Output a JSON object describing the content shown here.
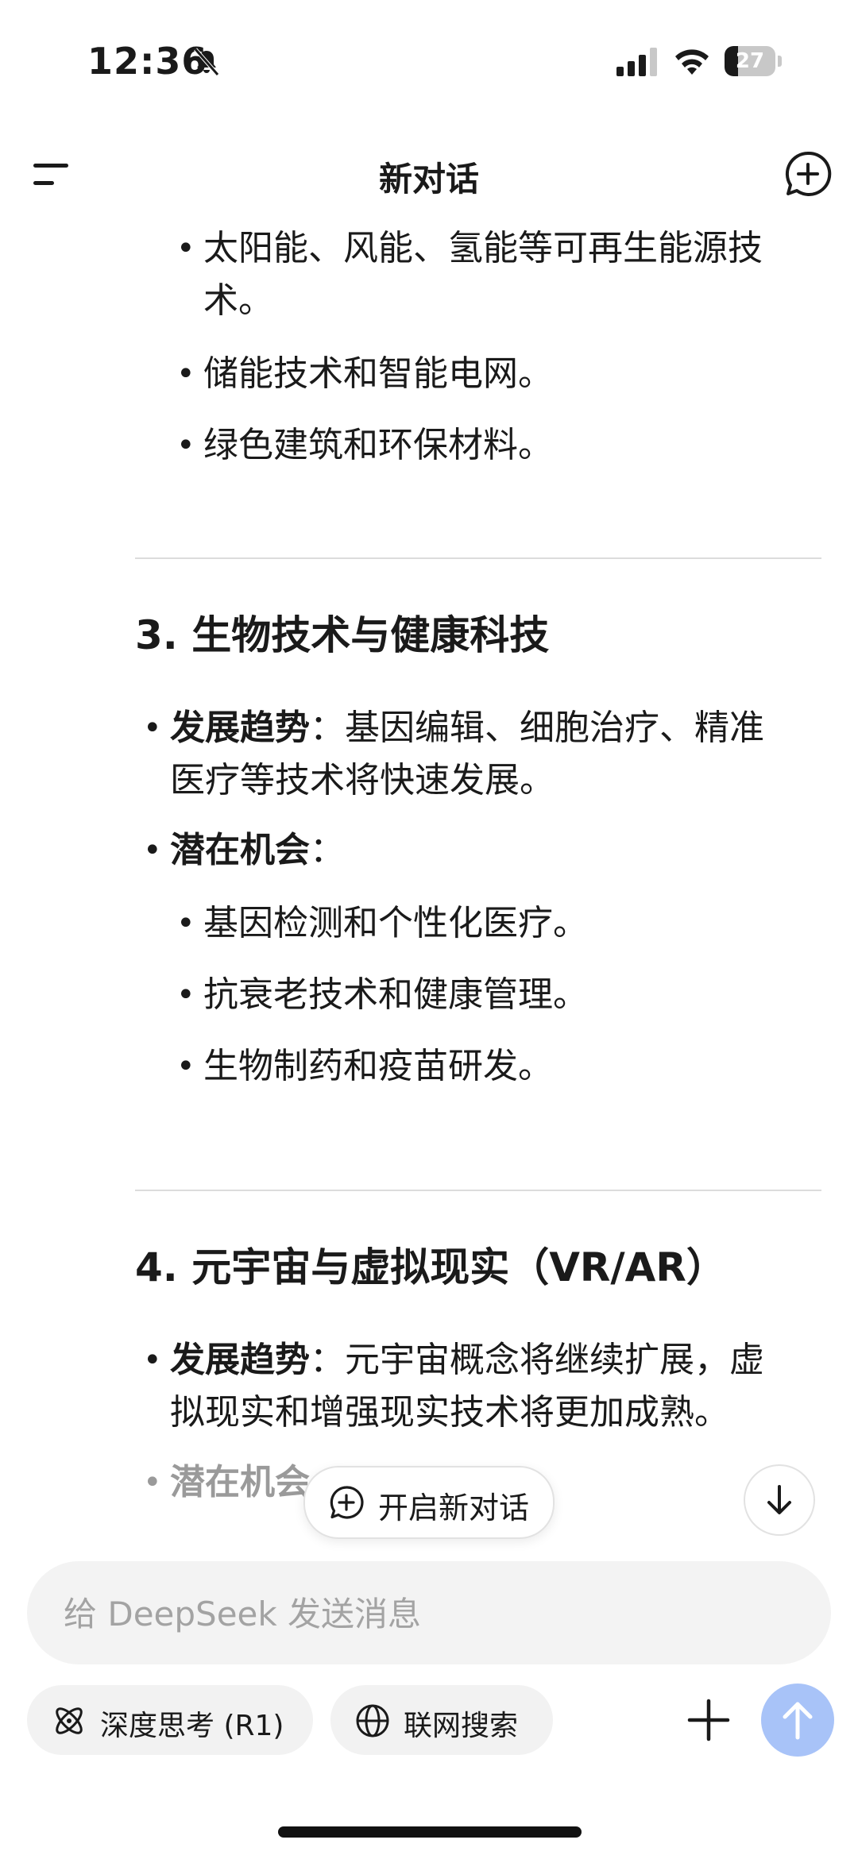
{
  "status_bar": {
    "time": "12:36",
    "battery_level": "27",
    "icons": [
      "bell-slash-icon",
      "cellular-signal-icon",
      "wifi-icon",
      "battery-icon"
    ]
  },
  "header": {
    "title": "新对话",
    "icons": [
      "menu-icon",
      "new-chat-icon"
    ]
  },
  "content": {
    "top_items": [
      "太阳能、风能、氢能等可再生能源技",
      "术。",
      "储能技术和智能电网。",
      "绿色建筑和环保材料。"
    ],
    "section3": {
      "heading": "3. 生物技术与健康科技",
      "trend_label": "发展趋势",
      "trend_line1": "：基因编辑、细胞治疗、精准",
      "trend_line2": "医疗等技术将快速发展。",
      "opp_label": "潜在机会",
      "opp_colon": "：",
      "items": [
        "基因检测和个性化医疗。",
        "抗衰老技术和健康管理。",
        "生物制药和疫苗研发。"
      ]
    },
    "section4": {
      "heading": "4. 元宇宙与虚拟现实（VR/AR）",
      "trend_label": "发展趋势",
      "trend_line1": "：元宇宙概念将继续扩展，虚",
      "trend_line2": "拟现实和增强现实技术将更加成熟。",
      "opp_label": "潜在机会"
    },
    "bullet": "•"
  },
  "floating": {
    "new_chat_label": "开启新对话"
  },
  "composer": {
    "placeholder": "给 DeepSeek 发送消息",
    "value": ""
  },
  "toolbar": {
    "deep_think_label": "深度思考 (R1)",
    "web_search_label": "联网搜索"
  },
  "colors": {
    "send_button": "#a8c3f8",
    "composer_bg": "#f3f3f3",
    "text": "#1a1a1a"
  }
}
